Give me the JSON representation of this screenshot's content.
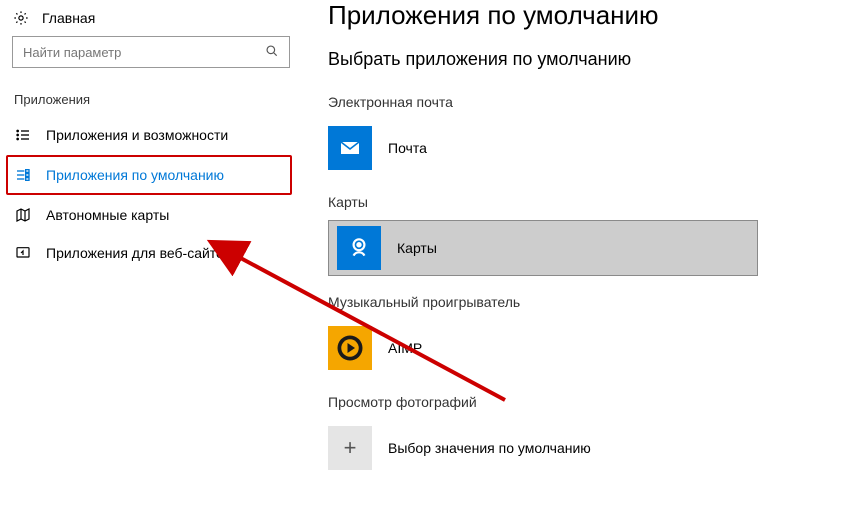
{
  "sidebar": {
    "home": "Главная",
    "search_placeholder": "Найти параметр",
    "heading": "Приложения",
    "items": [
      {
        "label": "Приложения и возможности"
      },
      {
        "label": "Приложения по умолчанию"
      },
      {
        "label": "Автономные карты"
      },
      {
        "label": "Приложения для веб-сайтов"
      }
    ]
  },
  "main": {
    "title": "Приложения по умолчанию",
    "subtitle": "Выбрать приложения по умолчанию",
    "sections": {
      "email": {
        "label": "Электронная почта",
        "app": "Почта"
      },
      "maps": {
        "label": "Карты",
        "app": "Карты"
      },
      "music": {
        "label": "Музыкальный проигрыватель",
        "app": "AIMP"
      },
      "photos": {
        "label": "Просмотр фотографий",
        "app": "Выбор значения по умолчанию"
      }
    }
  }
}
